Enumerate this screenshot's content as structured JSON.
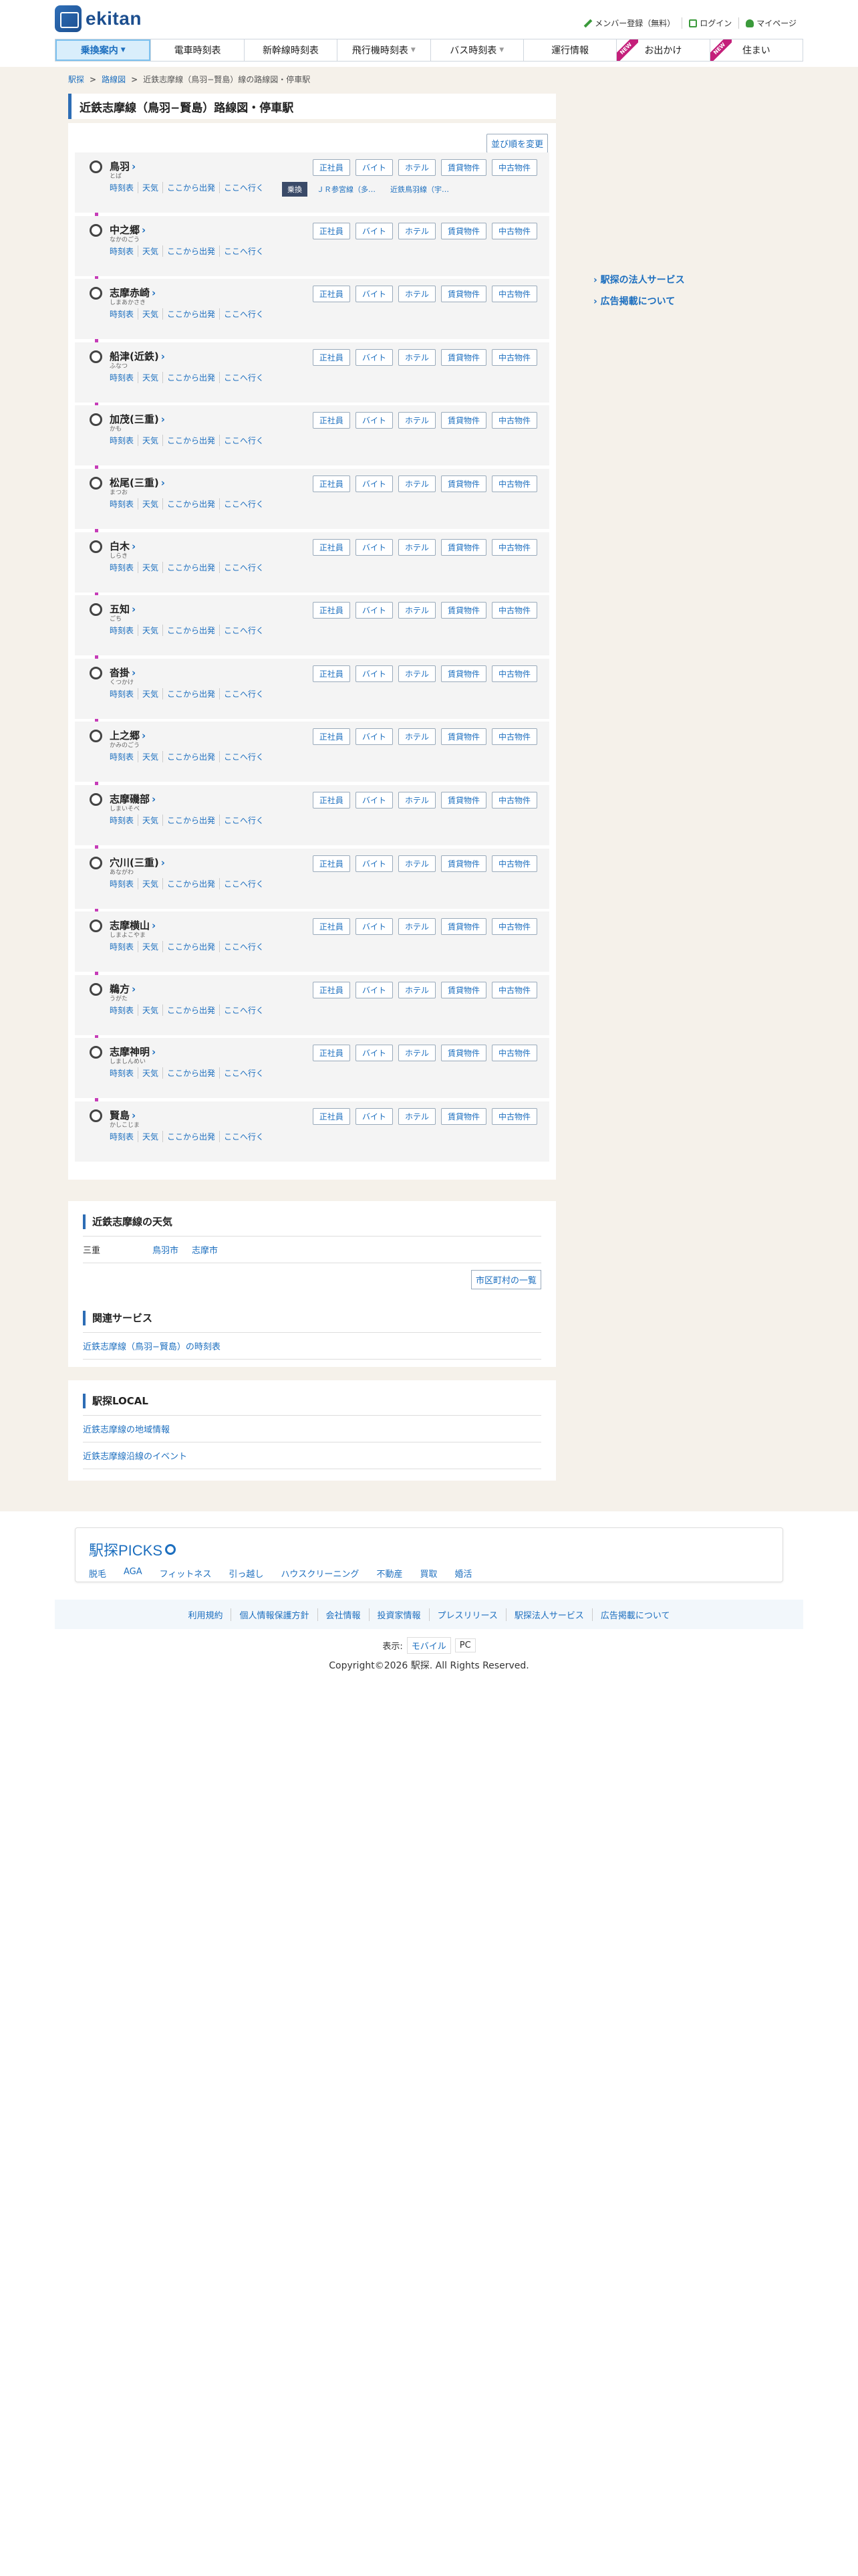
{
  "header": {
    "logo_text": "ekitan",
    "member_register": "メンバー登録（無料）",
    "login": "ログイン",
    "mypage": "マイページ"
  },
  "nav": {
    "items": [
      {
        "label": "乗換案内",
        "arrow": "▼"
      },
      {
        "label": "電車時刻表",
        "arrow": ""
      },
      {
        "label": "新幹線時刻表",
        "arrow": ""
      },
      {
        "label": "飛行機時刻表",
        "arrow": "▼"
      },
      {
        "label": "バス時刻表",
        "arrow": "▼"
      },
      {
        "label": "運行情報",
        "arrow": ""
      },
      {
        "label": "お出かけ",
        "arrow": "",
        "badge": "NEW"
      },
      {
        "label": "住まい",
        "arrow": "",
        "badge": "NEW"
      }
    ]
  },
  "breadcrumb": {
    "home": "駅探",
    "route_map": "路線図",
    "current": "近鉄志摩線（鳥羽−賢島）線の路線図・停車駅"
  },
  "main": {
    "title": "近鉄志摩線（鳥羽−賢島）路線図・停車駅",
    "sort_button": "並び順を変更",
    "link_labels": [
      "時刻表",
      "天気",
      "ここから出発",
      "ここへ行く"
    ],
    "button_labels": [
      "正社員",
      "バイト",
      "ホテル",
      "賃貸物件",
      "中古物件"
    ],
    "transfer_tag": "乗換",
    "transfer_lines": [
      "ＪＲ参宮線（多…",
      "近鉄鳥羽線（宇…"
    ],
    "stations": [
      {
        "name": "鳥羽",
        "kana": "とば"
      },
      {
        "name": "中之郷",
        "kana": "なかのごう"
      },
      {
        "name": "志摩赤崎",
        "kana": "しまあかさき"
      },
      {
        "name": "船津(近鉄)",
        "kana": "ふなつ"
      },
      {
        "name": "加茂(三重)",
        "kana": "かも"
      },
      {
        "name": "松尾(三重)",
        "kana": "まつお"
      },
      {
        "name": "白木",
        "kana": "しらき"
      },
      {
        "name": "五知",
        "kana": "ごち"
      },
      {
        "name": "沓掛",
        "kana": "くつかけ"
      },
      {
        "name": "上之郷",
        "kana": "かみのごう"
      },
      {
        "name": "志摩磯部",
        "kana": "しまいそべ"
      },
      {
        "name": "穴川(三重)",
        "kana": "あながわ"
      },
      {
        "name": "志摩横山",
        "kana": "しまよこやま"
      },
      {
        "name": "鵜方",
        "kana": "うがた"
      },
      {
        "name": "志摩神明",
        "kana": "しましんめい"
      },
      {
        "name": "賢島",
        "kana": "かしこじま"
      }
    ]
  },
  "side": {
    "corporate": "駅探の法人サービス",
    "ads": "広告掲載について"
  },
  "weather": {
    "title": "近鉄志摩線の天気",
    "pref": "三重",
    "cities": [
      "鳥羽市",
      "志摩市"
    ],
    "city_list_button": "市区町村の一覧"
  },
  "related": {
    "title": "関連サービス",
    "link": "近鉄志摩線（鳥羽−賢島）の時刻表"
  },
  "local": {
    "title": "駅探LOCAL",
    "links": [
      "近鉄志摩線の地域情報",
      "近鉄志摩線沿線のイベント"
    ]
  },
  "picks": {
    "title": "駅探PICKS",
    "links": [
      "脱毛",
      "AGA",
      "フィットネス",
      "引っ越し",
      "ハウスクリーニング",
      "不動産",
      "買取",
      "婚活"
    ]
  },
  "footer": {
    "links": [
      "利用規約",
      "個人情報保護方針",
      "会社情報",
      "投資家情報",
      "プレスリリース",
      "駅探法人サービス",
      "広告掲載について"
    ],
    "display_label": "表示:",
    "mobile": "モバイル",
    "pc": "PC",
    "copyright": "Copyright©2026 駅探. All Rights Reserved."
  }
}
